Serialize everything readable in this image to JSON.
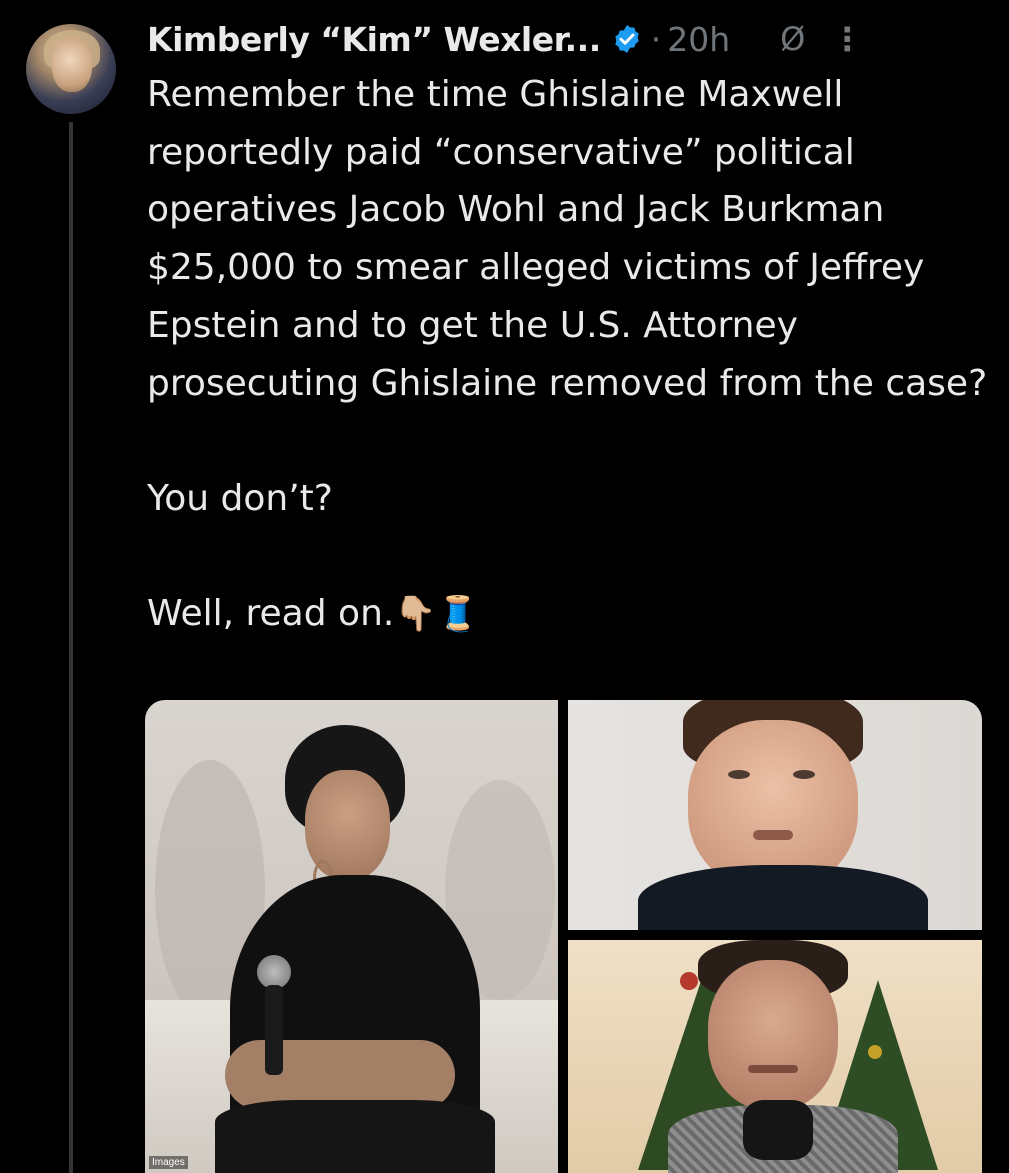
{
  "tweet": {
    "author_name": "Kimberly “Kim” Wexler...",
    "separator": "·",
    "timestamp": "20h",
    "no_sign_glyph": "Ø",
    "more_glyph": "⋮",
    "paragraphs": [
      "Remember the time Ghislaine Maxwell reportedly paid “conservative” political operatives Jacob Wohl and Jack Burkman $25,000 to smear alleged victims of Jeffrey Epstein and to get the U.S. Attorney prosecuting Ghislaine removed from the case?",
      "You don’t?",
      "Well, read on."
    ],
    "trailing_emojis": "👇🏼🧵"
  },
  "media": {
    "photo_count": 3,
    "left_photo_caption": "Images"
  },
  "colors": {
    "background": "#000000",
    "text_primary": "#e7e9ea",
    "text_secondary": "#71767b",
    "verified_blue": "#1d9bf0",
    "thread_line": "#333639"
  },
  "icons": {
    "verified": "verified-badge-icon",
    "no_sign": "grok-slash-icon",
    "more": "more-vertical-icon"
  }
}
